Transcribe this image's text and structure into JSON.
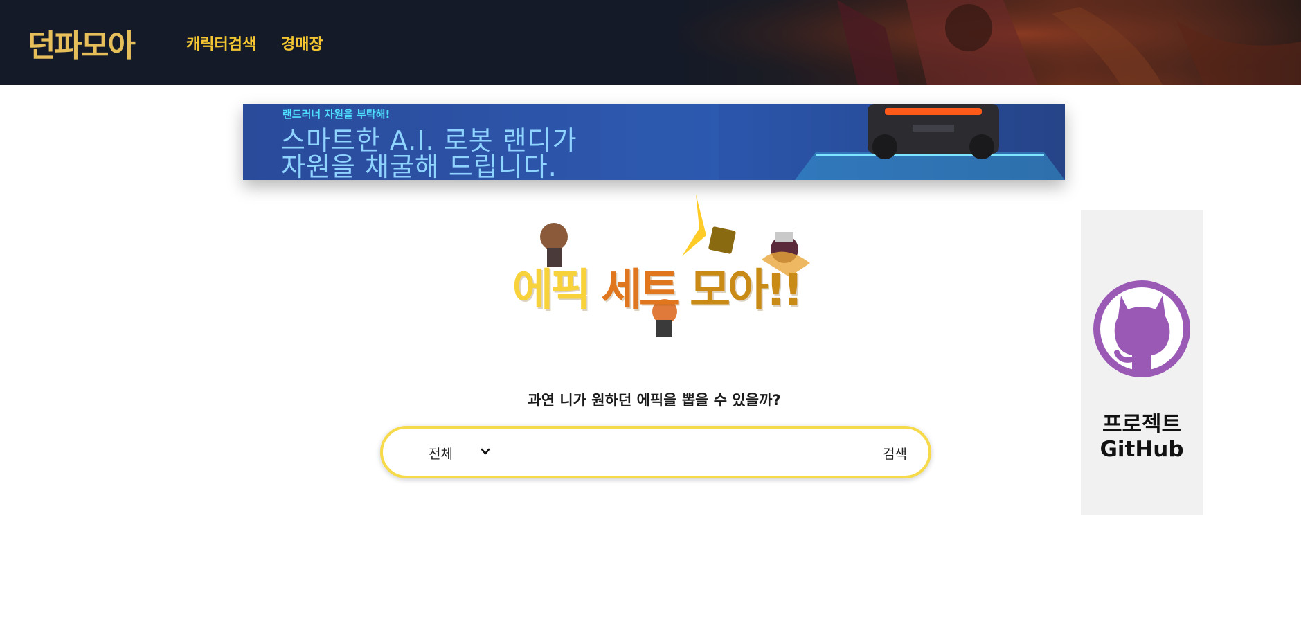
{
  "header": {
    "logo": "던파모아",
    "nav": [
      "캐릭터검색",
      "경매장"
    ]
  },
  "banner": {
    "small": "랜드러너 자원을 부탁해!",
    "line1": "스마트한 A.I. 로봇 랜디가",
    "line2": "자원을 채굴해 드립니다."
  },
  "hero": {
    "part1": "에픽",
    "part2": "세트",
    "part3": "모아!!"
  },
  "search": {
    "subtitle": "과연 니가 원하던 에픽을 뽑을 수 있을까?",
    "select_value": "전체",
    "button": "검색",
    "input_value": ""
  },
  "sidebar": {
    "line1": "프로젝트",
    "line2": "GitHub"
  },
  "colors": {
    "header_bg": "#141a27",
    "nav": "#f3c532",
    "logo": "#e6be5a",
    "search_border": "#f7da4a",
    "github": "#9b59b6"
  }
}
